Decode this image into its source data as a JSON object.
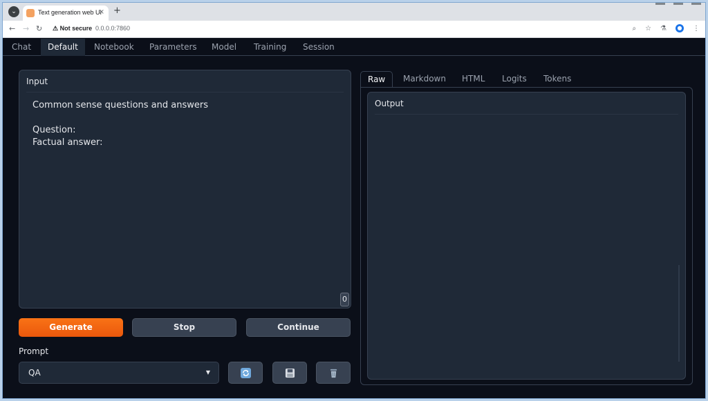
{
  "browser": {
    "tab_title": "Text generation web UI",
    "tab_close": "×",
    "new_tab": "+",
    "not_secure": "Not secure",
    "url": "0.0.0.0:7860"
  },
  "nav": {
    "tabs": [
      "Chat",
      "Default",
      "Notebook",
      "Parameters",
      "Model",
      "Training",
      "Session"
    ],
    "active": "Default"
  },
  "input": {
    "label": "Input",
    "text": "Common sense questions and answers\n\nQuestion:\nFactual answer:",
    "token_count": "0"
  },
  "buttons": {
    "generate": "Generate",
    "stop": "Stop",
    "continue": "Continue"
  },
  "prompt": {
    "label": "Prompt",
    "selected": "QA"
  },
  "icons": {
    "refresh": "refresh-icon",
    "save": "save-icon",
    "delete": "trash-icon"
  },
  "output_tabs": [
    "Raw",
    "Markdown",
    "HTML",
    "Logits",
    "Tokens"
  ],
  "output": {
    "label": "Output",
    "text": ""
  },
  "colors": {
    "background": "#0b0f19",
    "panel": "#1f2937",
    "accent": "#f97316"
  }
}
